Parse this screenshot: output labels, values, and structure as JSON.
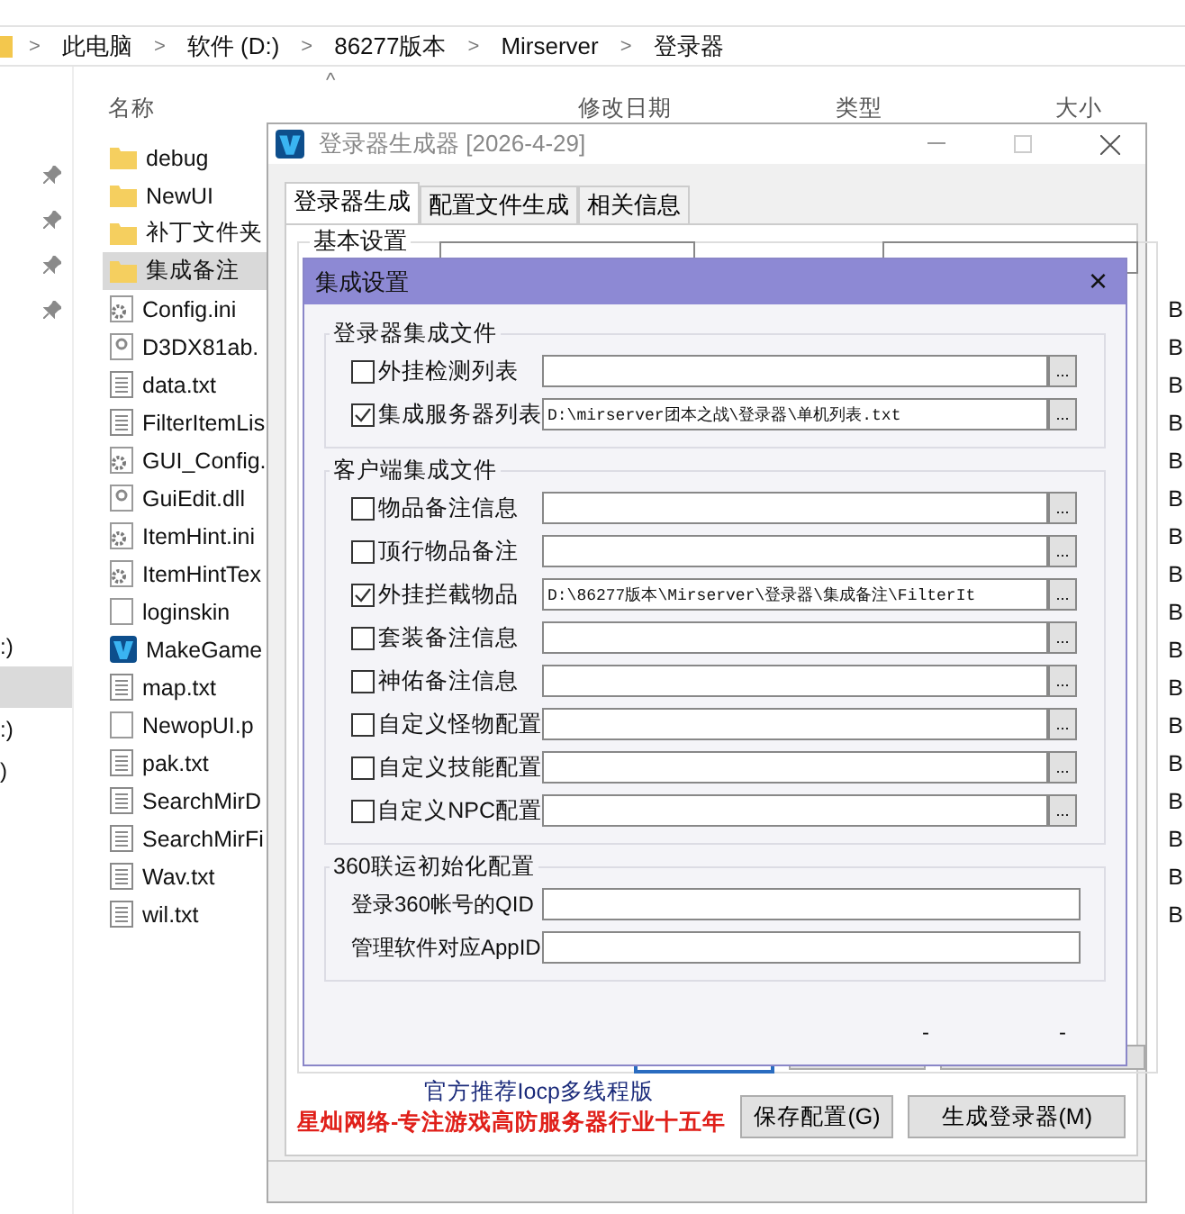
{
  "explorer": {
    "breadcrumb": [
      "此电脑",
      "软件 (D:)",
      "86277版本",
      "Mirserver",
      "登录器"
    ],
    "separator": ">",
    "columns": [
      "名称",
      "修改日期",
      "类型",
      "大小"
    ],
    "sort_caret": "^",
    "quick_access": [
      {
        "pinned": true
      },
      {
        "pinned": true
      },
      {
        "pinned": true
      },
      {
        "pinned": true
      }
    ],
    "drives": [
      {
        "label": ":)",
        "selected": false
      },
      {
        "selected": true
      },
      {
        "label": ":)",
        "selected": false
      },
      {
        "label": ")",
        "selected": false
      }
    ],
    "files": [
      {
        "name": "debug",
        "kind": "folder",
        "selected": false
      },
      {
        "name": "NewUI",
        "kind": "folder",
        "selected": false
      },
      {
        "name": "补丁文件夹",
        "kind": "folder",
        "selected": false
      },
      {
        "name": "集成备注",
        "kind": "folder",
        "selected": true
      },
      {
        "name": "Config.ini",
        "kind": "config",
        "size": "B",
        "selected": false
      },
      {
        "name": "D3DX81ab.",
        "kind": "library",
        "size": "B",
        "selected": false
      },
      {
        "name": "data.txt",
        "kind": "text",
        "size": "B",
        "selected": false
      },
      {
        "name": "FilterItemLis",
        "kind": "text",
        "size": "B",
        "selected": false
      },
      {
        "name": "GUI_Config.",
        "kind": "config",
        "size": "B",
        "selected": false
      },
      {
        "name": "GuiEdit.dll",
        "kind": "library",
        "size": "B",
        "selected": false
      },
      {
        "name": "ItemHint.ini",
        "kind": "config",
        "size": "B",
        "selected": false
      },
      {
        "name": "ItemHintTex",
        "kind": "config",
        "size": "B",
        "selected": false
      },
      {
        "name": "loginskin",
        "kind": "blank",
        "size": "B",
        "selected": false
      },
      {
        "name": "MakeGame",
        "kind": "app",
        "size": "B",
        "selected": false
      },
      {
        "name": "map.txt",
        "kind": "text",
        "size": "B",
        "selected": false
      },
      {
        "name": "NewopUI.p",
        "kind": "blank",
        "size": "B",
        "selected": false
      },
      {
        "name": "pak.txt",
        "kind": "text",
        "size": "B",
        "selected": false
      },
      {
        "name": "SearchMirD",
        "kind": "text",
        "size": "B",
        "selected": false
      },
      {
        "name": "SearchMirFi",
        "kind": "text",
        "size": "B",
        "selected": false
      },
      {
        "name": "Wav.txt",
        "kind": "text",
        "size": "B",
        "selected": false
      },
      {
        "name": "wil.txt",
        "kind": "text",
        "size": "B",
        "selected": false
      }
    ]
  },
  "main_window": {
    "title": "登录器生成器 [2026-4-29]",
    "tabs": [
      {
        "label": "登录器生成",
        "selected": true
      },
      {
        "label": "配置文件生成",
        "selected": false
      },
      {
        "label": "相关信息",
        "selected": false
      }
    ],
    "group": "基本设置",
    "fragments": [
      "-",
      "-"
    ],
    "notice": "官方推荐Iocp多线程版",
    "slogan": "星灿网络-专注游戏高防服务器行业十五年",
    "buttons": [
      "保存配置(G)",
      "生成登录器(M)"
    ]
  },
  "dialog": {
    "title": "集成设置",
    "close": "×",
    "sections": [
      {
        "title": "登录器集成文件",
        "rows": [
          {
            "kind": "file",
            "label": "外挂检测列表",
            "checked": false,
            "button": "..."
          },
          {
            "kind": "file",
            "label": "集成服务器列表",
            "checked": true,
            "value": "D:\\mirserver团本之战\\登录器\\单机列表.txt",
            "button": "..."
          }
        ]
      },
      {
        "title": "客户端集成文件",
        "rows": [
          {
            "kind": "file",
            "label": "物品备注信息",
            "checked": false,
            "button": "..."
          },
          {
            "kind": "file",
            "label": "顶行物品备注",
            "checked": false,
            "button": "..."
          },
          {
            "kind": "file",
            "label": "外挂拦截物品",
            "checked": true,
            "value": "D:\\86277版本\\Mirserver\\登录器\\集成备注\\FilterIt",
            "button": "..."
          },
          {
            "kind": "file",
            "label": "套装备注信息",
            "checked": false,
            "button": "..."
          },
          {
            "kind": "file",
            "label": "神佑备注信息",
            "checked": false,
            "button": "..."
          },
          {
            "kind": "file",
            "label": "自定义怪物配置",
            "checked": false,
            "button": "..."
          },
          {
            "kind": "file",
            "label": "自定义技能配置",
            "checked": false,
            "button": "..."
          },
          {
            "kind": "file",
            "label": "自定义NPC配置",
            "checked": false,
            "button": "..."
          }
        ]
      },
      {
        "title": "360联运初始化配置",
        "rows": [
          {
            "kind": "text",
            "label": "登录360帐号的QID"
          },
          {
            "kind": "text",
            "label": "管理软件对应AppID"
          }
        ]
      }
    ]
  }
}
